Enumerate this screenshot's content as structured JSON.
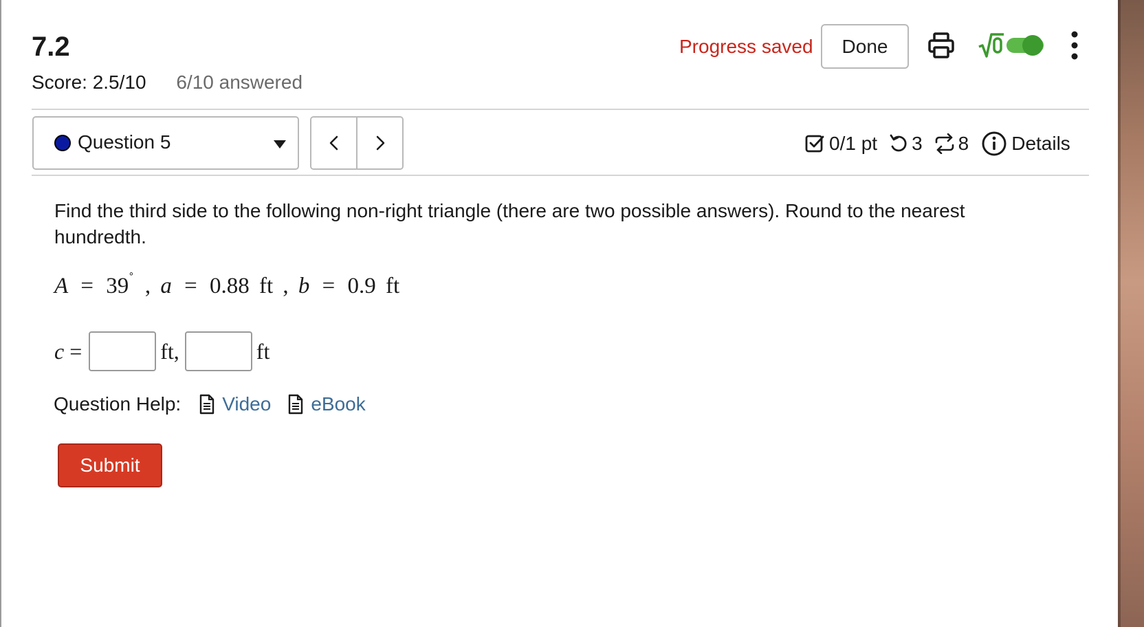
{
  "header": {
    "title": "7.2",
    "score": "Score: 2.5/10",
    "answered": "6/10 answered",
    "progress_status": "Progress saved",
    "done_label": "Done",
    "print_icon": "printer-icon",
    "math_toggle_icon": "sqrt-zero-icon",
    "math_toggle_on": true,
    "menu_icon": "vertical-dots-icon"
  },
  "question_nav": {
    "selected": "Question 5",
    "status_color": "#0a1aa0",
    "prev_icon": "chevron-left-icon",
    "next_icon": "chevron-right-icon"
  },
  "question_meta": {
    "points": "0/1 pt",
    "attempts": "3",
    "retries": "8",
    "details_label": "Details"
  },
  "question": {
    "prompt": "Find the third side to the following non-right triangle (there are two possible answers). Round to the nearest hundredth.",
    "given": {
      "angle_var": "A",
      "angle_value": "39",
      "degree_symbol": "˚",
      "side_a_var": "a",
      "side_a_value": "0.88",
      "side_b_var": "b",
      "side_b_value": "0.9",
      "unit": "ft",
      "equals": "=",
      "comma": ","
    },
    "answer": {
      "var": "c",
      "equals": "=",
      "unit_first": "ft,",
      "unit_second": "ft",
      "input1_value": "",
      "input2_value": ""
    }
  },
  "help": {
    "label": "Question Help:",
    "video_label": "Video",
    "ebook_label": "eBook"
  },
  "submit_label": "Submit",
  "colors": {
    "accent_red": "#c9261c",
    "submit_bg": "#d63a24",
    "link_blue": "#3e6d97",
    "toggle_green": "#3d9a2f"
  }
}
